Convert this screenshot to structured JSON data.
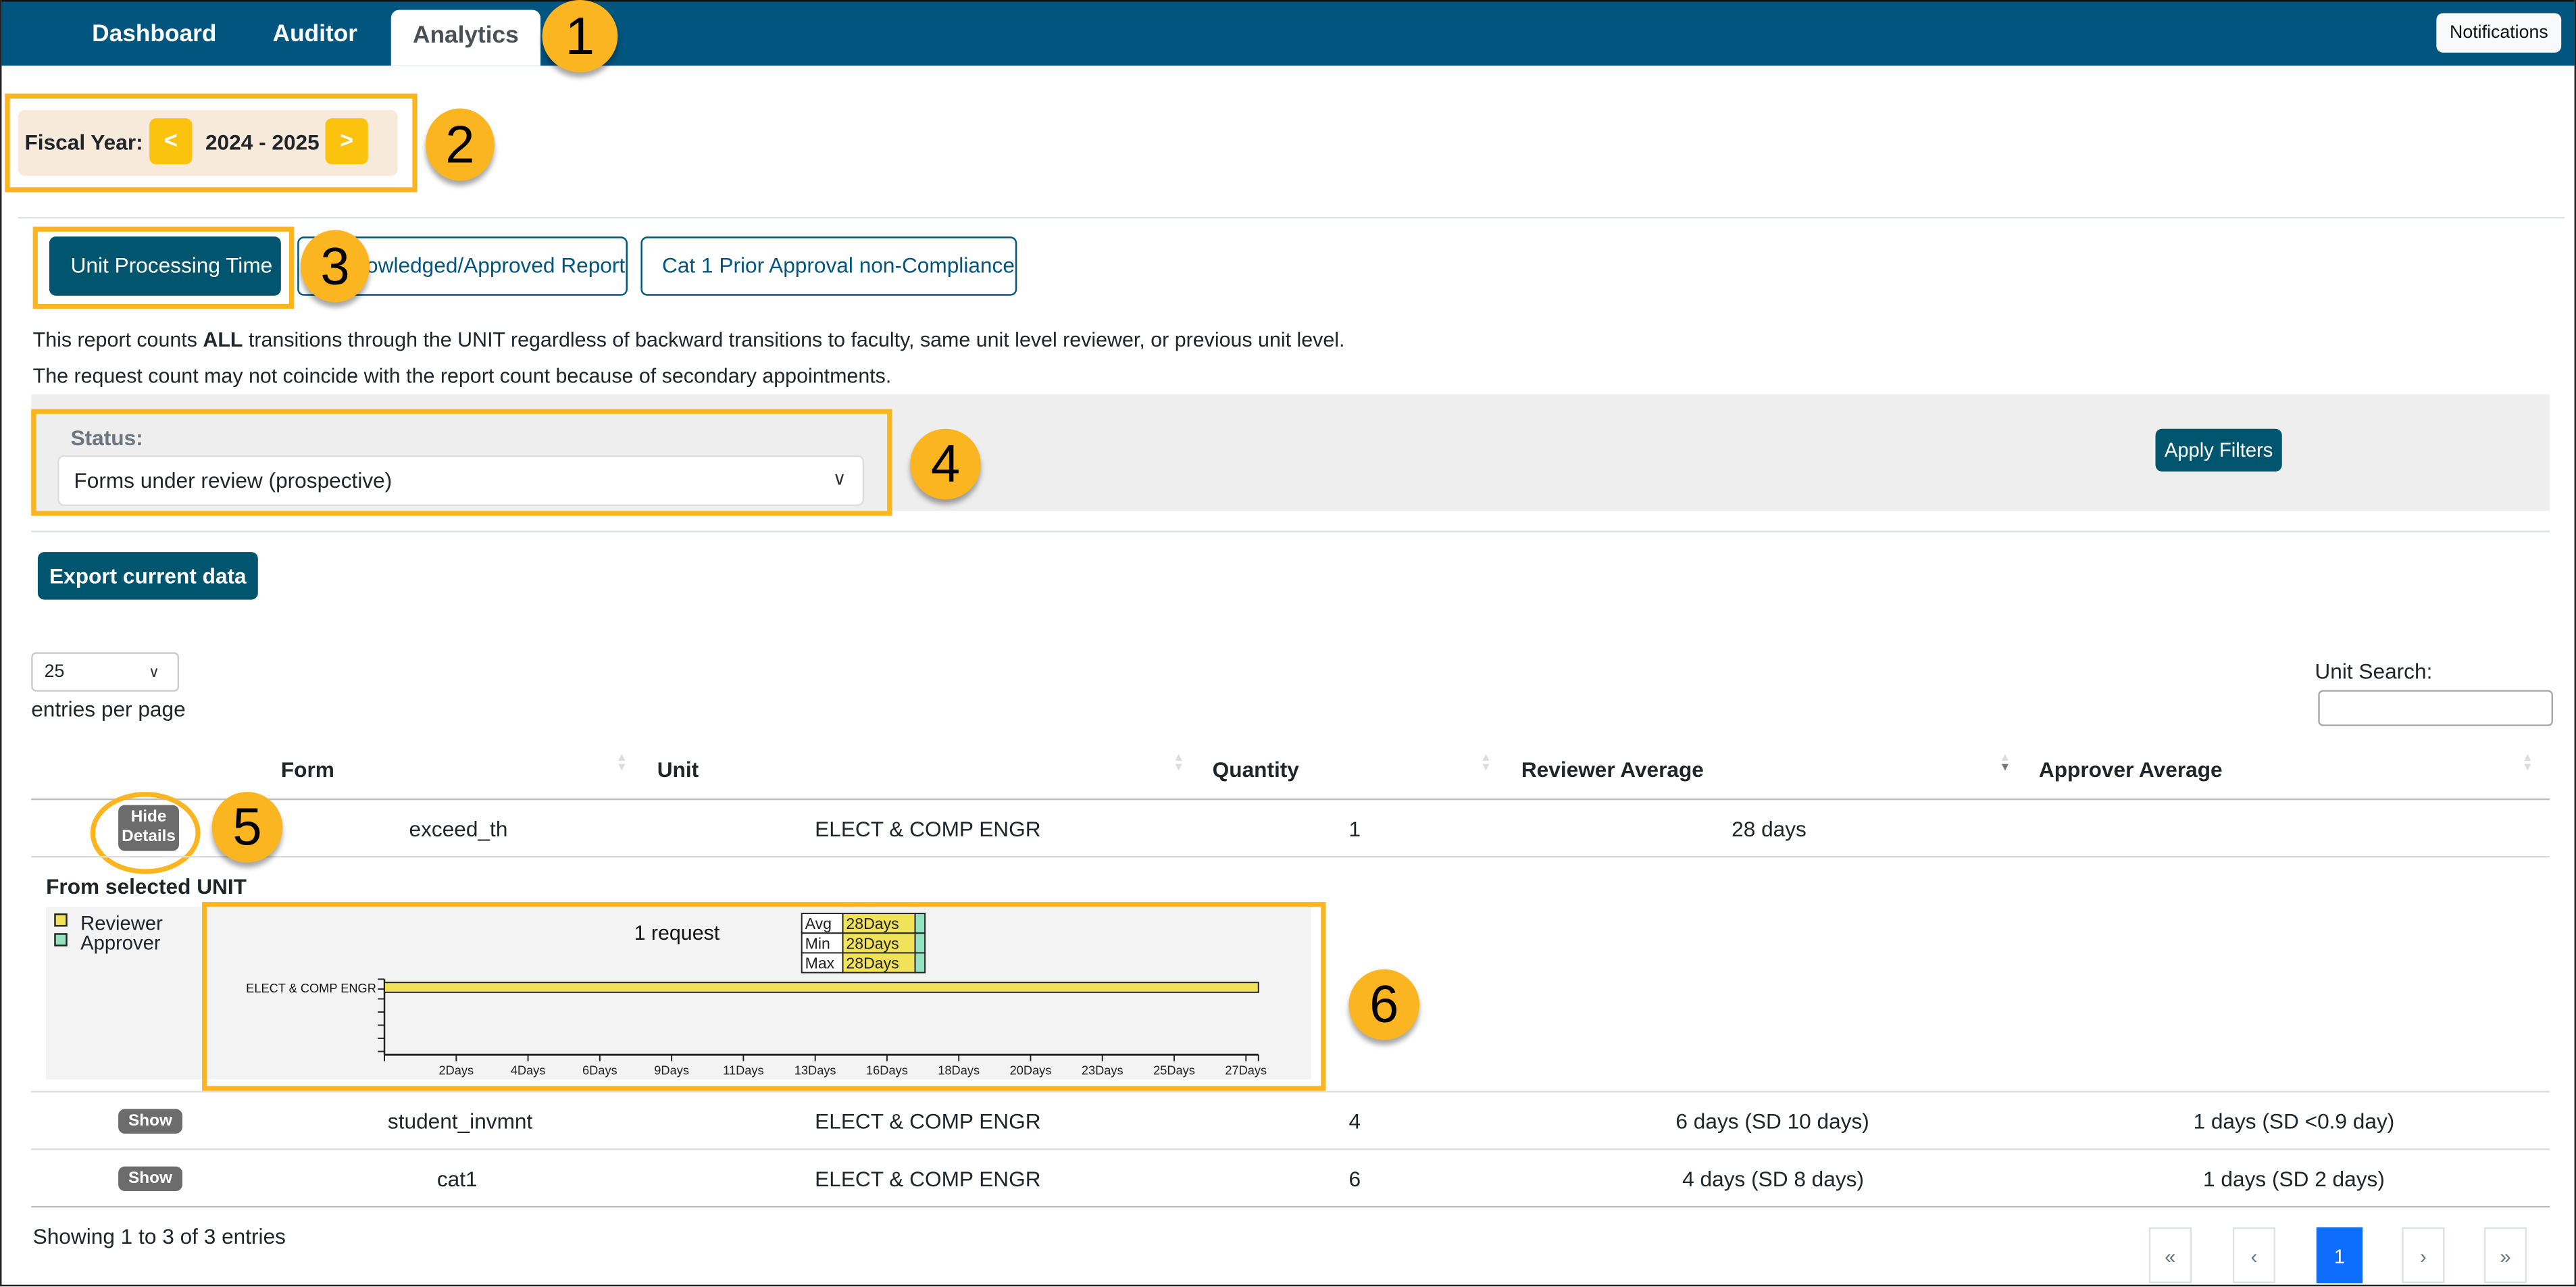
{
  "nav": {
    "tabs": [
      {
        "label": "Dashboard",
        "active": false
      },
      {
        "label": "Auditor",
        "active": false
      },
      {
        "label": "Analytics",
        "active": true
      }
    ],
    "notifications_label": "Notifications"
  },
  "callouts": [
    "1",
    "2",
    "3",
    "4",
    "5",
    "6"
  ],
  "fiscal_year": {
    "label": "Fiscal Year:",
    "prev_label": "<",
    "next_label": ">",
    "value": "2024 - 2025"
  },
  "report_tabs": [
    {
      "label": "Unit Processing Time",
      "active": true
    },
    {
      "label": "Acknowledged/Approved Report",
      "active": false
    },
    {
      "label": "Cat 1 Prior Approval non-Compliance",
      "active": false
    }
  ],
  "info": {
    "line1_pre": "This report counts ",
    "line1_bold": "ALL",
    "line1_post": " transitions through the UNIT regardless of backward transitions to faculty, same unit level reviewer, or previous unit level.",
    "line2": "The request count may not coincide with the report count because of secondary appointments."
  },
  "filters": {
    "status_label": "Status:",
    "status_value": "Forms under review (prospective)",
    "apply_label": "Apply Filters"
  },
  "export_label": "Export current data",
  "table_controls": {
    "page_length": "25",
    "page_length_label": "entries per page",
    "search_label": "Unit Search:",
    "search_value": ""
  },
  "table": {
    "columns": [
      "Form",
      "Unit",
      "Quantity",
      "Reviewer Average",
      "Approver Average"
    ],
    "sorted_column": "Reviewer Average",
    "sort_direction": "desc",
    "rows": [
      {
        "toggle": "Hide Details",
        "form": "exceed_th",
        "unit": "ELECT & COMP ENGR",
        "quantity": "1",
        "reviewer_avg": "28 days",
        "approver_avg": "",
        "expanded": true
      },
      {
        "toggle": "Show",
        "form": "student_invmnt",
        "unit": "ELECT & COMP ENGR",
        "quantity": "4",
        "reviewer_avg": "6 days (SD 10 days)",
        "approver_avg": "1 days (SD <0.9 day)",
        "expanded": false
      },
      {
        "toggle": "Show",
        "form": "cat1",
        "unit": "ELECT & COMP ENGR",
        "quantity": "6",
        "reviewer_avg": "4 days (SD 8 days)",
        "approver_avg": "1 days (SD 2 days)",
        "expanded": false
      }
    ]
  },
  "detail": {
    "title": "From selected UNIT",
    "legend": [
      {
        "label": "Reviewer",
        "color": "#f0e35a"
      },
      {
        "label": "Approver",
        "color": "#95e0c0"
      }
    ],
    "request_count_label": "1 request",
    "stats": [
      {
        "label": "Avg",
        "value": "28Days"
      },
      {
        "label": "Min",
        "value": "28Days"
      },
      {
        "label": "Max",
        "value": "28Days"
      }
    ]
  },
  "chart_data": {
    "type": "bar",
    "orientation": "horizontal",
    "title": "1 request",
    "categories": [
      "ELECT & COMP ENGR"
    ],
    "series": [
      {
        "name": "Reviewer",
        "color": "#f0e35a",
        "values": [
          28
        ]
      },
      {
        "name": "Approver",
        "color": "#95e0c0",
        "values": [
          0
        ]
      }
    ],
    "xlabel": "",
    "ylabel": "",
    "x_tick_labels": [
      "2Days",
      "4Days",
      "6Days",
      "9Days",
      "11Days",
      "13Days",
      "16Days",
      "18Days",
      "20Days",
      "23Days",
      "25Days",
      "27Days"
    ],
    "x_tick_values": [
      2.3,
      4.6,
      6.9,
      9.2,
      11.5,
      13.8,
      16.1,
      18.4,
      20.7,
      23.0,
      25.3,
      27.6
    ],
    "xlim": [
      0,
      28
    ],
    "legend_position": "left",
    "grid": false
  },
  "footer": {
    "summary": "Showing 1 to 3 of 3 entries",
    "pagination": [
      {
        "label": "«",
        "name": "first"
      },
      {
        "label": "‹",
        "name": "previous"
      },
      {
        "label": "1",
        "name": "page-1",
        "active": true
      },
      {
        "label": "›",
        "name": "next"
      },
      {
        "label": "»",
        "name": "last"
      }
    ]
  }
}
